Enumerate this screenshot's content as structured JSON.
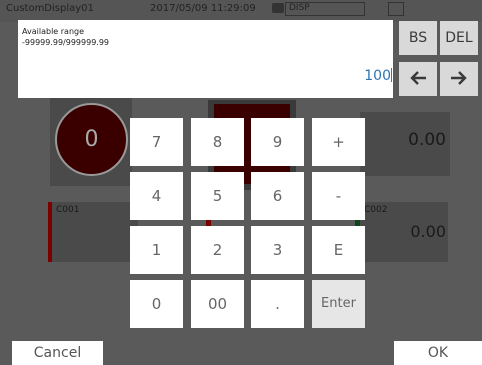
{
  "titlebar": {
    "name": "CustomDisplay01",
    "datetime": "2017/05/09  11:29:09",
    "disp_label": "DISP"
  },
  "background": {
    "lamp_value": "0",
    "numeric_right": "0.00",
    "tag_c001": "C001",
    "tag_c002": "C002",
    "numeric_c002": "0.00",
    "lamp_color": "#3a0000"
  },
  "input": {
    "range_label": "Available range",
    "range_value": "-99999.99/999999.99",
    "entry_value": "100"
  },
  "edit_keys": {
    "bs": "BS",
    "del": "DEL",
    "left_icon": "arrow-left-icon",
    "right_icon": "arrow-right-icon"
  },
  "keypad": {
    "k7": "7",
    "k8": "8",
    "k9": "9",
    "plus": "+",
    "k4": "4",
    "k5": "5",
    "k6": "6",
    "minus": "-",
    "k1": "1",
    "k2": "2",
    "k3": "3",
    "exp": "E",
    "k0": "0",
    "k00": "00",
    "dot": ".",
    "enter": "Enter"
  },
  "footer": {
    "cancel": "Cancel",
    "ok": "OK"
  },
  "colors": {
    "accent": "#2e75b6",
    "overlay": "#5a5a5a",
    "key_bg": "#ffffff",
    "edit_key_bg": "#d9d9d9"
  }
}
